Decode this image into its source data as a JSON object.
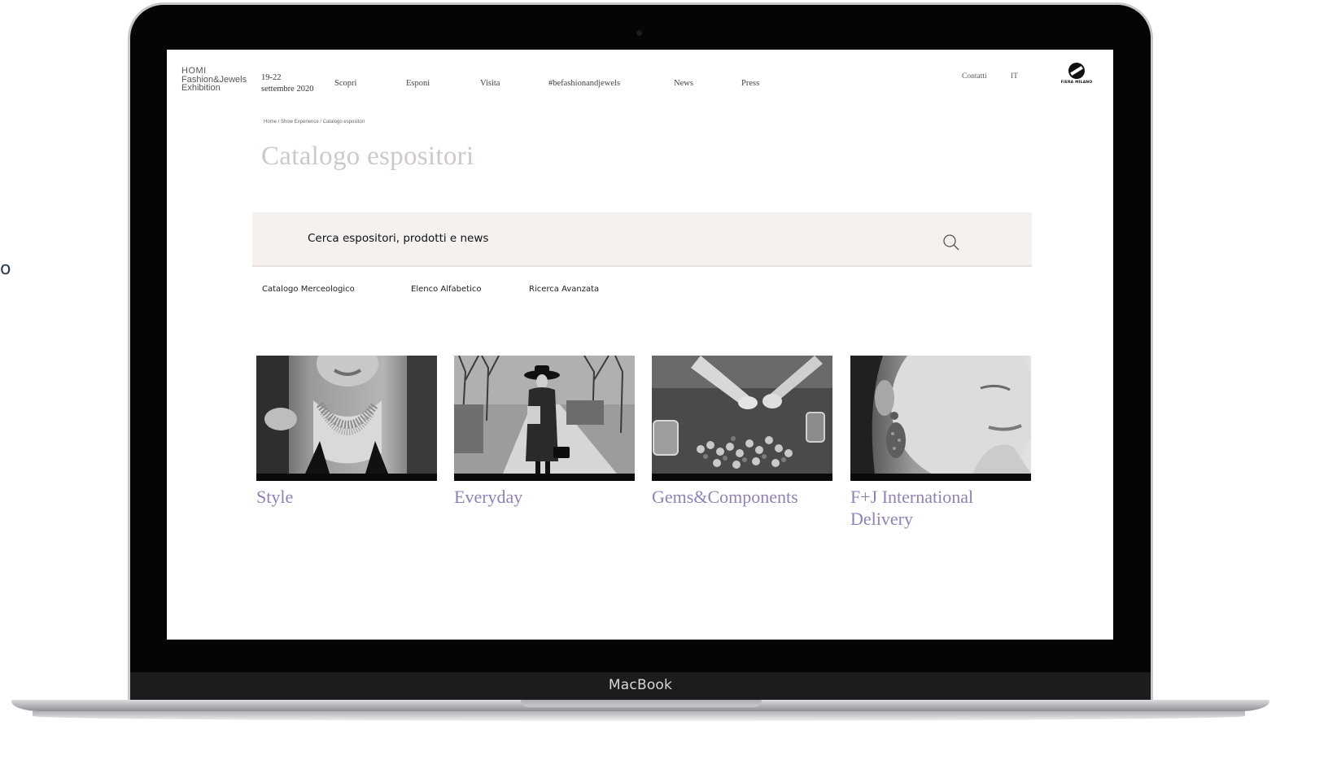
{
  "stray_text": "o",
  "site": {
    "logo_lines": [
      "HOMI",
      "Fashion&Jewels",
      "Exhibition"
    ],
    "dates": [
      "19-22",
      "settembre 2020"
    ],
    "nav": [
      "Scopri",
      "Esponi",
      "Visita",
      "#befashionandjewels",
      "News",
      "Press"
    ],
    "contact": "Contatti",
    "lang": "IT",
    "partner_logo_text": "FIERA MILANO"
  },
  "breadcrumb": "Home / Show Experience / Catalogo espositori",
  "page_title": "Catalogo espositori",
  "search": {
    "placeholder": "Cerca espositori, prodotti e news"
  },
  "tabs": [
    "Catalogo Merceologico",
    "Elenco Alfabetico",
    "Ricerca Avanzata"
  ],
  "categories": [
    {
      "label": "Style",
      "icon": "necklace-photo"
    },
    {
      "label": "Everyday",
      "icon": "street-fashion-photo"
    },
    {
      "label": "Gems&Components",
      "icon": "beads-photo"
    },
    {
      "label": "F+J International Delivery",
      "icon": "earring-photo"
    }
  ],
  "device_label": "MacBook",
  "colors": {
    "title": "#cfc8c8",
    "category": "#8f82b4",
    "search_bg": "#f4f1ef"
  }
}
